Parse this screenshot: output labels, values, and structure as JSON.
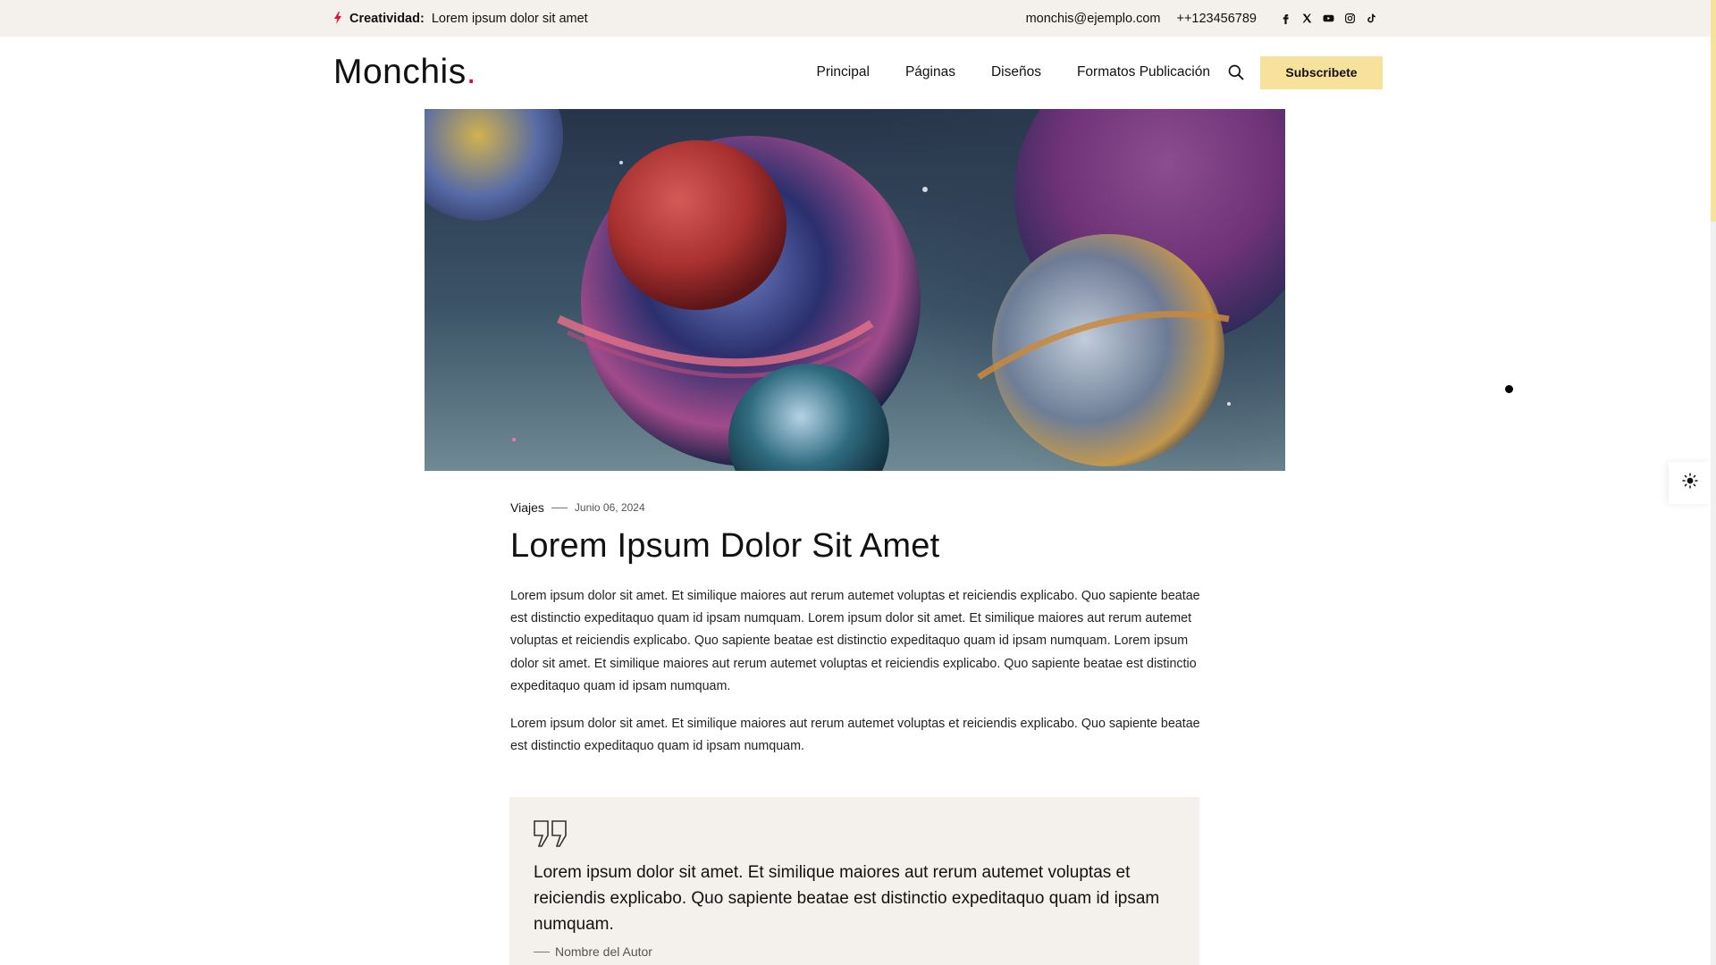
{
  "topbar": {
    "label": "Creatividad:",
    "text": "Lorem ipsum dolor sit amet",
    "email": "monchis@ejemplo.com",
    "phone": "++123456789",
    "socials": [
      "facebook-icon",
      "x-icon",
      "youtube-icon",
      "instagram-icon",
      "tiktok-icon"
    ]
  },
  "header": {
    "logo": "Monchis",
    "logo_dot": ".",
    "nav": [
      "Principal",
      "Páginas",
      "Diseños",
      "Formatos Publicación"
    ],
    "subscribe_label": "Subscribete"
  },
  "article": {
    "category": "Viajes",
    "date": "Junio 06, 2024",
    "title": "Lorem Ipsum Dolor Sit Amet",
    "paragraphs": [
      "Lorem ipsum dolor sit amet. Et similique maiores aut rerum autemet voluptas et reiciendis explicabo. Quo sapiente beatae est distinctio expeditaquo quam id ipsam numquam. Lorem ipsum dolor sit amet. Et similique maiores aut rerum autemet voluptas et reiciendis explicabo. Quo sapiente beatae est distinctio expeditaquo quam id ipsam numquam. Lorem ipsum dolor sit amet. Et similique maiores aut rerum autemet voluptas et reiciendis explicabo. Quo sapiente beatae est distinctio expeditaquo quam id ipsam numquam.",
      "Lorem ipsum dolor sit amet. Et similique maiores aut rerum autemet voluptas et reiciendis explicabo. Quo sapiente beatae est distinctio expeditaquo quam id ipsam numquam."
    ],
    "quote": {
      "text": "Lorem ipsum dolor sit amet. Et similique maiores aut rerum autemet voluptas et reiciendis explicabo. Quo sapiente beatae est distinctio expeditaquo quam id ipsam numquam.",
      "author": "Nombre del Autor"
    }
  },
  "colors": {
    "accent": "#f7e29c",
    "brand_red": "#e3102b",
    "soft_bg": "#f4f1ec"
  },
  "widgets": {
    "theme_toggle_icon": "sun-icon",
    "scroll_progress": 0.23
  }
}
